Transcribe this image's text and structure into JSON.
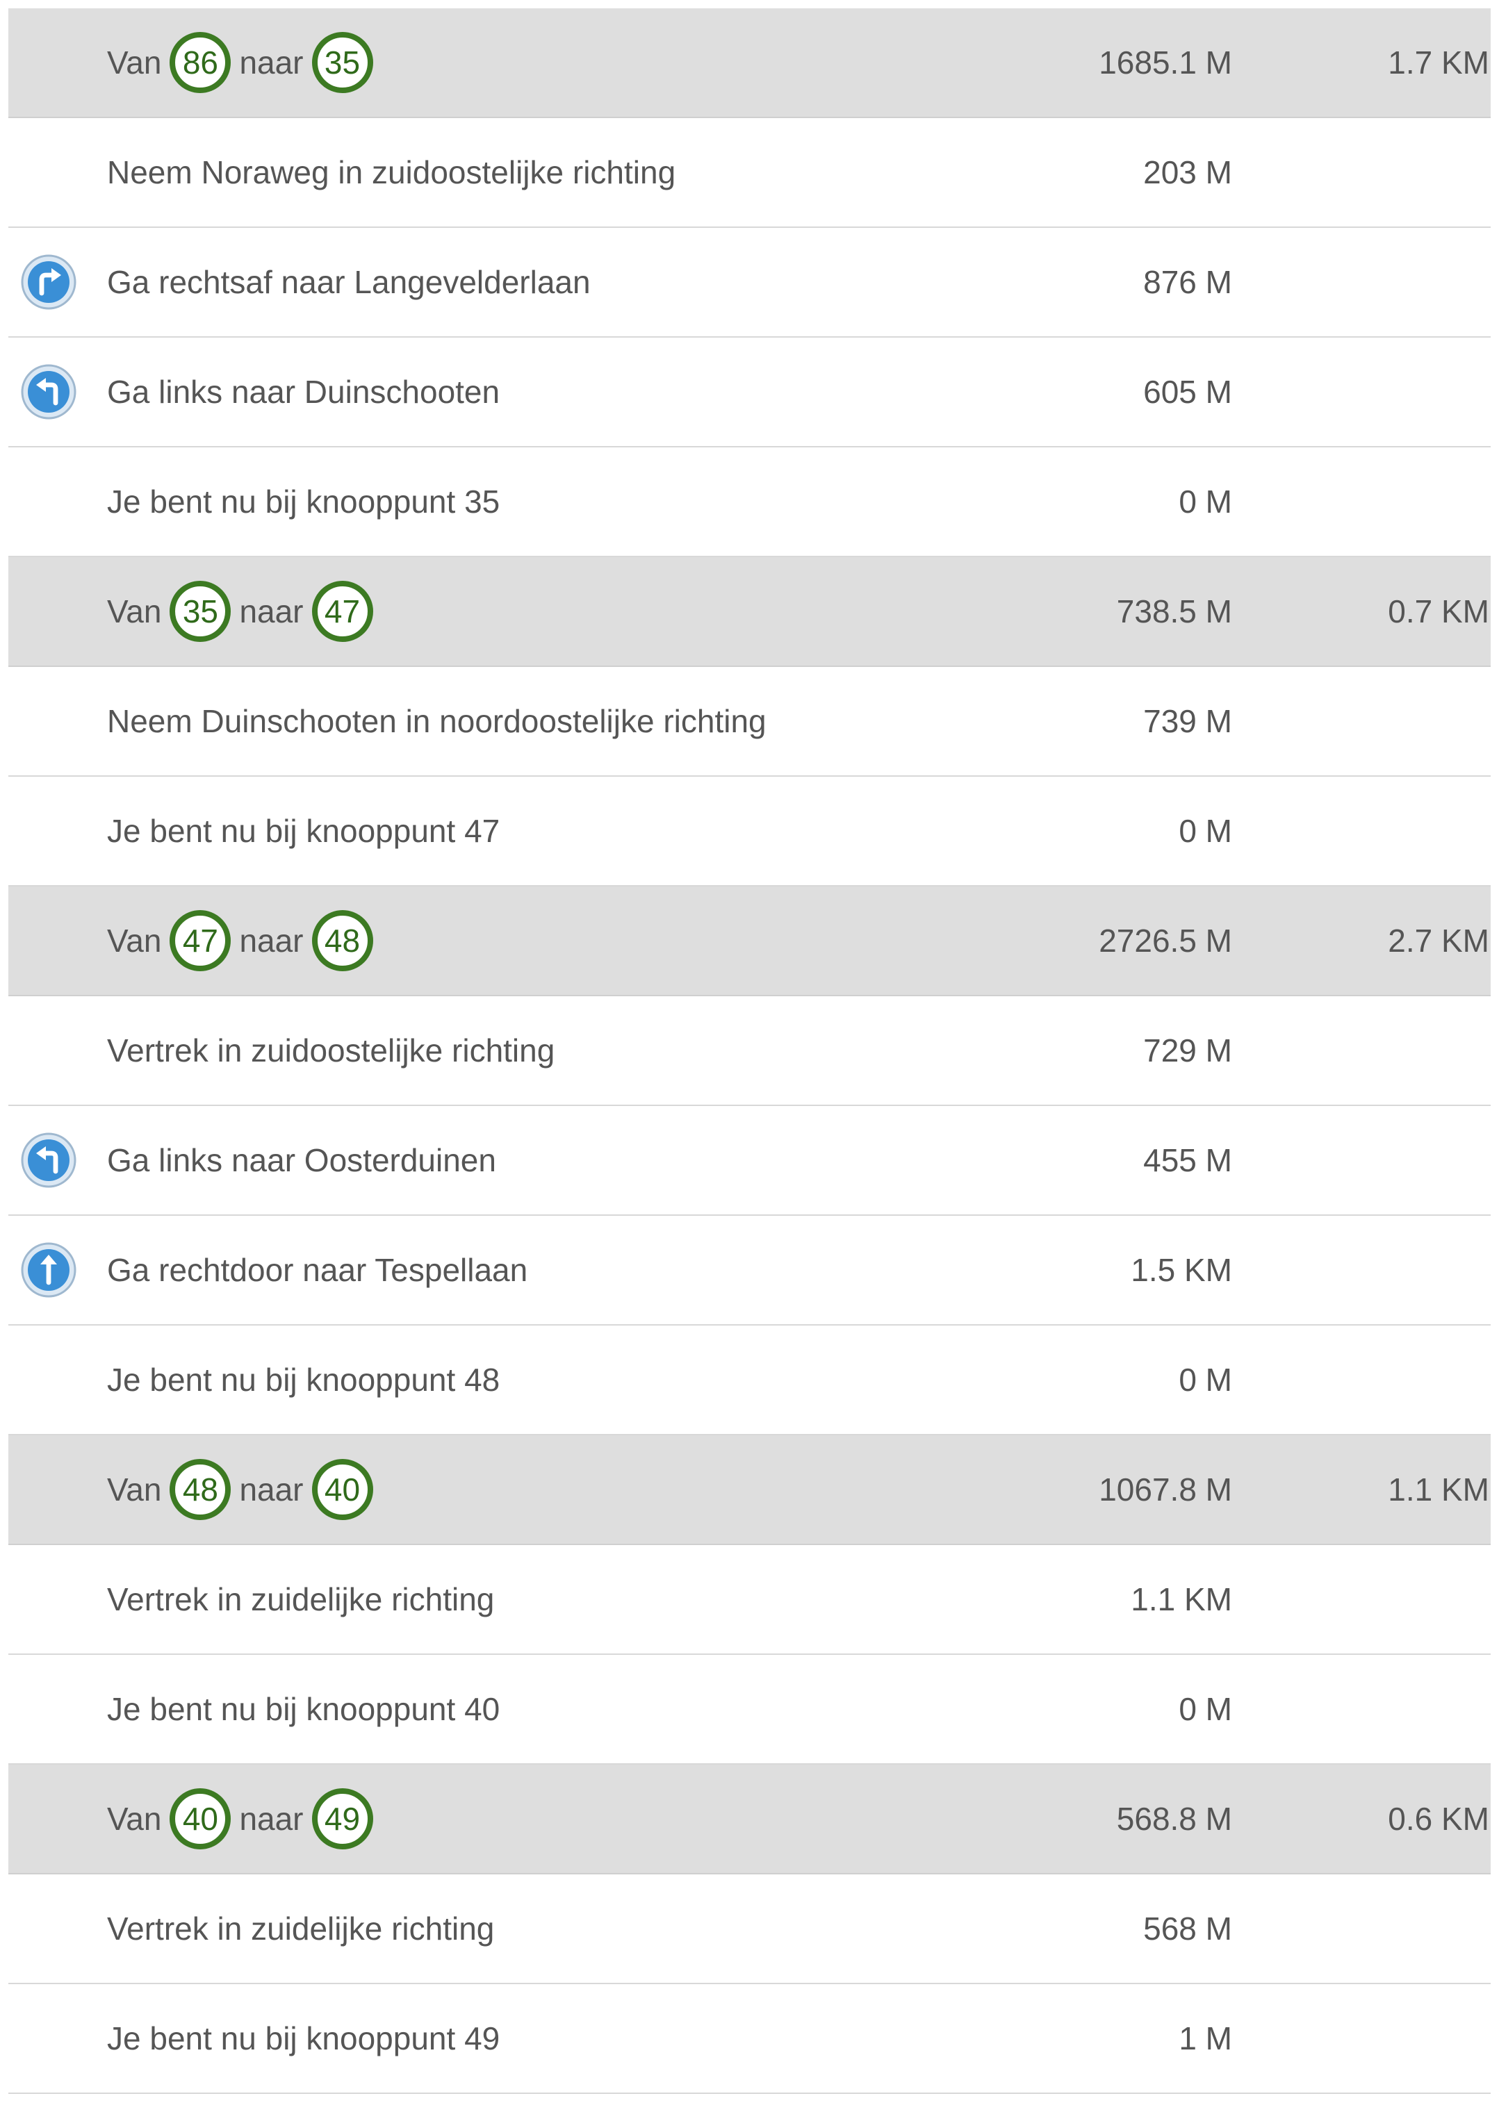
{
  "colors": {
    "segment_background": "#dedede",
    "node_ring": "#3c7a22",
    "node_text": "#2f6a1a",
    "turn_icon": "#3a8fd6",
    "text": "#555555",
    "divider": "#d8d8d8"
  },
  "labels": {
    "from": "Van",
    "to": "naar"
  },
  "rows": [
    {
      "kind": "segment",
      "from": "86",
      "to": "35",
      "distance": "1685.1 M",
      "total": "1.7 KM"
    },
    {
      "kind": "step",
      "icon": "",
      "text": "Neem Noraweg in zuidoostelijke richting",
      "distance": "203 M"
    },
    {
      "kind": "step",
      "icon": "turn-right-icon",
      "text": "Ga rechtsaf naar Langevelderlaan",
      "distance": "876 M"
    },
    {
      "kind": "step",
      "icon": "turn-left-icon",
      "text": "Ga links naar Duinschooten",
      "distance": "605 M"
    },
    {
      "kind": "step",
      "icon": "",
      "text": "Je bent nu bij knooppunt 35",
      "distance": "0 M"
    },
    {
      "kind": "segment",
      "from": "35",
      "to": "47",
      "distance": "738.5 M",
      "total": "0.7 KM"
    },
    {
      "kind": "step",
      "icon": "",
      "text": "Neem Duinschooten in noordoostelijke richting",
      "distance": "739 M"
    },
    {
      "kind": "step",
      "icon": "",
      "text": "Je bent nu bij knooppunt 47",
      "distance": "0 M"
    },
    {
      "kind": "segment",
      "from": "47",
      "to": "48",
      "distance": "2726.5 M",
      "total": "2.7 KM"
    },
    {
      "kind": "step",
      "icon": "",
      "text": "Vertrek in zuidoostelijke richting",
      "distance": "729 M"
    },
    {
      "kind": "step",
      "icon": "turn-left-icon",
      "text": "Ga links naar Oosterduinen",
      "distance": "455 M"
    },
    {
      "kind": "step",
      "icon": "straight-ahead-icon",
      "text": "Ga rechtdoor naar Tespellaan",
      "distance": "1.5 KM"
    },
    {
      "kind": "step",
      "icon": "",
      "text": "Je bent nu bij knooppunt 48",
      "distance": "0 M"
    },
    {
      "kind": "segment",
      "from": "48",
      "to": "40",
      "distance": "1067.8 M",
      "total": "1.1 KM"
    },
    {
      "kind": "step",
      "icon": "",
      "text": "Vertrek in zuidelijke richting",
      "distance": "1.1 KM"
    },
    {
      "kind": "step",
      "icon": "",
      "text": "Je bent nu bij knooppunt 40",
      "distance": "0 M"
    },
    {
      "kind": "segment",
      "from": "40",
      "to": "49",
      "distance": "568.8 M",
      "total": "0.6 KM"
    },
    {
      "kind": "step",
      "icon": "",
      "text": "Vertrek in zuidelijke richting",
      "distance": "568 M"
    },
    {
      "kind": "step",
      "icon": "",
      "text": "Je bent nu bij knooppunt 49",
      "distance": "1 M"
    }
  ]
}
